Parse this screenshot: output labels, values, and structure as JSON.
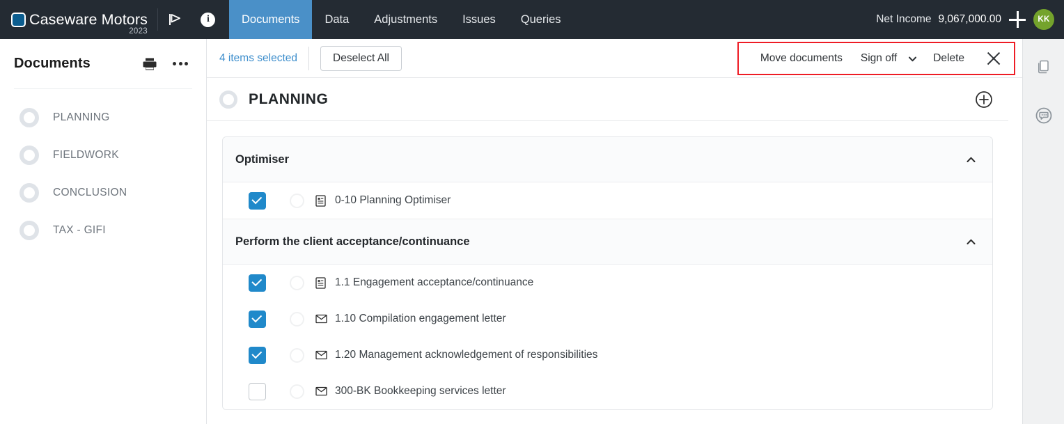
{
  "topbar": {
    "brand_name": "Caseware Motors",
    "brand_year": "2023",
    "flag_icon": "flag-icon",
    "info_icon": "info-icon",
    "tabs": [
      {
        "label": "Documents",
        "active": true
      },
      {
        "label": "Data",
        "active": false
      },
      {
        "label": "Adjustments",
        "active": false
      },
      {
        "label": "Issues",
        "active": false
      },
      {
        "label": "Queries",
        "active": false
      }
    ],
    "net_income_label": "Net Income",
    "net_income_value": "9,067,000.00",
    "add_icon": "plus-icon",
    "avatar_initials": "KK",
    "avatar_color": "#74a32c",
    "bar_color": "#242b33",
    "active_tab_color": "#4a90c8"
  },
  "sidebar": {
    "title": "Documents",
    "print_icon": "printer-icon",
    "more_icon": "more-options-icon",
    "items": [
      {
        "label": "PLANNING"
      },
      {
        "label": "FIELDWORK"
      },
      {
        "label": "CONCLUSION"
      },
      {
        "label": "TAX - GIFI"
      }
    ]
  },
  "action_bar": {
    "selected_count": "4 items selected",
    "deselect_label": "Deselect All",
    "highlight_color": "#ee1c25",
    "actions": {
      "move_label": "Move documents",
      "signoff_label": "Sign off",
      "signoff_caret_icon": "chevron-down-icon",
      "delete_label": "Delete",
      "close_icon": "close-icon"
    }
  },
  "phase": {
    "title": "PLANNING",
    "status_icon": "signoff-ring-icon",
    "add_icon": "plus-circle-icon"
  },
  "sections": [
    {
      "title": "Optimiser",
      "collapse_icon": "chevron-up-icon",
      "documents": [
        {
          "checked": true,
          "icon": "form-document-icon",
          "label": "0-10 Planning Optimiser"
        }
      ]
    },
    {
      "title": "Perform the client acceptance/continuance",
      "collapse_icon": "chevron-up-icon",
      "documents": [
        {
          "checked": true,
          "icon": "form-document-icon",
          "label": "1.1 Engagement acceptance/continuance"
        },
        {
          "checked": true,
          "icon": "letter-document-icon",
          "label": "1.10 Compilation engagement letter"
        },
        {
          "checked": true,
          "icon": "letter-document-icon",
          "label": "1.20 Management acknowledgement of responsibilities"
        },
        {
          "checked": false,
          "icon": "letter-document-icon",
          "label": "300-BK Bookkeeping services letter"
        }
      ]
    }
  ],
  "rail": {
    "items": [
      {
        "icon": "copy-documents-icon"
      },
      {
        "icon": "chat-assistant-icon"
      }
    ]
  }
}
